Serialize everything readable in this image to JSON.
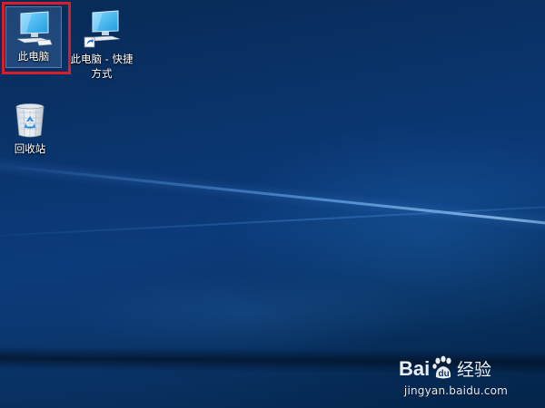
{
  "desktop": {
    "icons": [
      {
        "label": "此电脑",
        "icon": "computer-icon",
        "selected": true
      },
      {
        "label": "此电脑 - 快捷方式",
        "icon": "computer-shortcut-icon",
        "selected": false
      },
      {
        "label": "回收站",
        "icon": "recycle-bin-icon",
        "selected": false
      }
    ]
  },
  "watermark": {
    "brand": "Baidu经验",
    "url": "jingyan.baidu.com"
  },
  "colors": {
    "highlight": "#d81e2c",
    "wallpaper": "#0a3670"
  }
}
